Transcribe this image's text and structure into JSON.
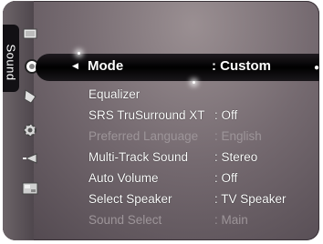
{
  "sidebar": {
    "tab_label": "Sound"
  },
  "menu": {
    "current": {
      "label": "Mode",
      "value": ": Custom"
    },
    "items": [
      {
        "label": "Equalizer",
        "value": "",
        "enabled": true
      },
      {
        "label": "SRS TruSurround XT",
        "value": ": Off",
        "enabled": true
      },
      {
        "label": "Preferred Language",
        "value": ": English",
        "enabled": false
      },
      {
        "label": "Multi-Track Sound",
        "value": ": Stereo",
        "enabled": true
      },
      {
        "label": "Auto Volume",
        "value": ": Off",
        "enabled": true
      },
      {
        "label": "Select Speaker",
        "value": ": TV Speaker",
        "enabled": true
      },
      {
        "label": "Sound Select",
        "value": ": Main",
        "enabled": false
      }
    ]
  },
  "icons": [
    "picture-icon",
    "sound-icon",
    "channel-icon",
    "setup-icon",
    "input-icon",
    "application-icon"
  ],
  "colors": {
    "highlight": "#000000",
    "text": "#ffffff",
    "disabled": "#9d9599",
    "panel": "#756a70"
  }
}
